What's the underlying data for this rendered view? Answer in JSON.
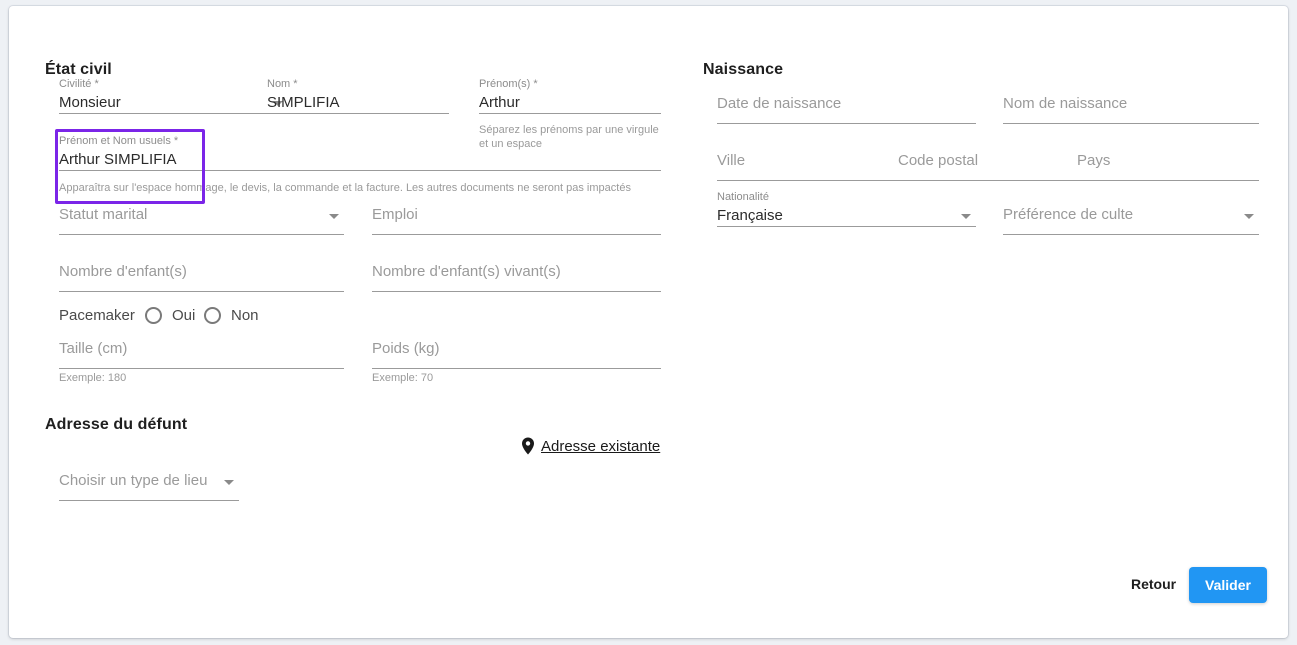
{
  "sections": {
    "etat_civil": {
      "title": "État civil"
    },
    "naissance": {
      "title": "Naissance"
    },
    "adresse": {
      "title": "Adresse du défunt"
    }
  },
  "fields": {
    "civilite": {
      "label": "Civilité *",
      "value": "Monsieur",
      "icon": "chevron-down-icon"
    },
    "nom": {
      "label": "Nom *",
      "value": "SIMPLIFIA"
    },
    "prenoms": {
      "label": "Prénom(s) *",
      "value": "Arthur",
      "hint": "Séparez les prénoms par une virgule et un espace"
    },
    "prenom_nom_usuels": {
      "label": "Prénom et Nom usuels *",
      "value": "Arthur SIMPLIFIA",
      "hint": "Apparaîtra sur l'espace hommage, le devis, la commande et la facture. Les autres documents ne seront pas impactés",
      "highlight_color": "#7b25e8"
    },
    "statut_marital": {
      "placeholder": "Statut marital",
      "value": "",
      "icon": "chevron-down-icon"
    },
    "emploi": {
      "placeholder": "Emploi",
      "value": ""
    },
    "nombre_enfants": {
      "placeholder": "Nombre d'enfant(s)",
      "value": ""
    },
    "nombre_enfants_vivants": {
      "placeholder": "Nombre d'enfant(s) vivant(s)",
      "value": ""
    },
    "pacemaker": {
      "label": "Pacemaker",
      "options": [
        "Oui",
        "Non"
      ],
      "selected": ""
    },
    "taille": {
      "placeholder": "Taille (cm)",
      "value": "",
      "hint": "Exemple: 180"
    },
    "poids": {
      "placeholder": "Poids (kg)",
      "value": "",
      "hint": "Exemple: 70"
    },
    "date_naissance": {
      "placeholder": "Date de naissance",
      "value": ""
    },
    "nom_naissance": {
      "placeholder": "Nom de naissance",
      "value": ""
    },
    "ville": {
      "placeholder": "Ville",
      "value": ""
    },
    "code_postal": {
      "placeholder": "Code postal",
      "value": ""
    },
    "pays": {
      "placeholder": "Pays",
      "value": ""
    },
    "nationalite": {
      "label": "Nationalité",
      "value": "Française",
      "icon": "chevron-down-icon"
    },
    "preference_culte": {
      "placeholder": "Préférence de culte",
      "value": "",
      "icon": "chevron-down-icon"
    },
    "type_lieu": {
      "placeholder": "Choisir un type de lieu",
      "value": "",
      "icon": "chevron-down-icon"
    }
  },
  "links": {
    "adresse_existante": {
      "label": "Adresse existante",
      "icon": "map-pin-icon"
    }
  },
  "footer": {
    "back_label": "Retour",
    "submit_label": "Valider",
    "submit_color": "#2196f3"
  }
}
